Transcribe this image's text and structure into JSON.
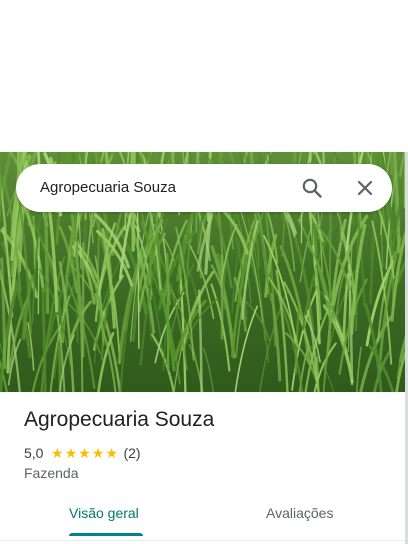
{
  "search": {
    "query": "Agropecuaria Souza",
    "search_icon": "search-icon",
    "close_icon": "close-icon"
  },
  "hero": {
    "image": "grass-field-photo"
  },
  "place": {
    "name": "Agropecuaria Souza",
    "rating": "5,0",
    "stars": 5,
    "review_count": "(2)",
    "category": "Fazenda"
  },
  "tabs": [
    {
      "label": "Visão geral",
      "active": true
    },
    {
      "label": "Avaliações",
      "active": false
    }
  ],
  "colors": {
    "accent": "#00796b",
    "star": "#fbbc04",
    "text": "#202124",
    "muted": "#5f6368"
  }
}
